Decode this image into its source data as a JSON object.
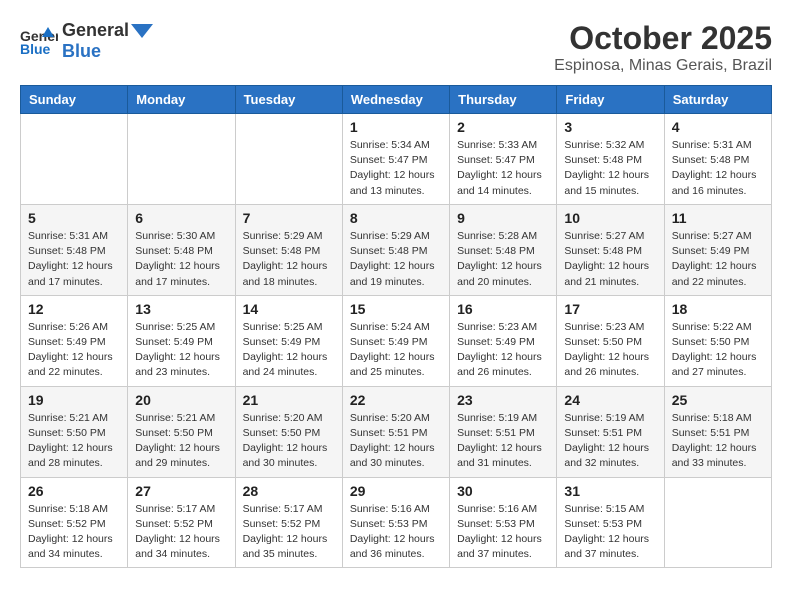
{
  "header": {
    "logo_general": "General",
    "logo_blue": "Blue",
    "month_year": "October 2025",
    "location": "Espinosa, Minas Gerais, Brazil"
  },
  "weekdays": [
    "Sunday",
    "Monday",
    "Tuesday",
    "Wednesday",
    "Thursday",
    "Friday",
    "Saturday"
  ],
  "weeks": [
    [
      {
        "day": "",
        "info": ""
      },
      {
        "day": "",
        "info": ""
      },
      {
        "day": "",
        "info": ""
      },
      {
        "day": "1",
        "info": "Sunrise: 5:34 AM\nSunset: 5:47 PM\nDaylight: 12 hours\nand 13 minutes."
      },
      {
        "day": "2",
        "info": "Sunrise: 5:33 AM\nSunset: 5:47 PM\nDaylight: 12 hours\nand 14 minutes."
      },
      {
        "day": "3",
        "info": "Sunrise: 5:32 AM\nSunset: 5:48 PM\nDaylight: 12 hours\nand 15 minutes."
      },
      {
        "day": "4",
        "info": "Sunrise: 5:31 AM\nSunset: 5:48 PM\nDaylight: 12 hours\nand 16 minutes."
      }
    ],
    [
      {
        "day": "5",
        "info": "Sunrise: 5:31 AM\nSunset: 5:48 PM\nDaylight: 12 hours\nand 17 minutes."
      },
      {
        "day": "6",
        "info": "Sunrise: 5:30 AM\nSunset: 5:48 PM\nDaylight: 12 hours\nand 17 minutes."
      },
      {
        "day": "7",
        "info": "Sunrise: 5:29 AM\nSunset: 5:48 PM\nDaylight: 12 hours\nand 18 minutes."
      },
      {
        "day": "8",
        "info": "Sunrise: 5:29 AM\nSunset: 5:48 PM\nDaylight: 12 hours\nand 19 minutes."
      },
      {
        "day": "9",
        "info": "Sunrise: 5:28 AM\nSunset: 5:48 PM\nDaylight: 12 hours\nand 20 minutes."
      },
      {
        "day": "10",
        "info": "Sunrise: 5:27 AM\nSunset: 5:48 PM\nDaylight: 12 hours\nand 21 minutes."
      },
      {
        "day": "11",
        "info": "Sunrise: 5:27 AM\nSunset: 5:49 PM\nDaylight: 12 hours\nand 22 minutes."
      }
    ],
    [
      {
        "day": "12",
        "info": "Sunrise: 5:26 AM\nSunset: 5:49 PM\nDaylight: 12 hours\nand 22 minutes."
      },
      {
        "day": "13",
        "info": "Sunrise: 5:25 AM\nSunset: 5:49 PM\nDaylight: 12 hours\nand 23 minutes."
      },
      {
        "day": "14",
        "info": "Sunrise: 5:25 AM\nSunset: 5:49 PM\nDaylight: 12 hours\nand 24 minutes."
      },
      {
        "day": "15",
        "info": "Sunrise: 5:24 AM\nSunset: 5:49 PM\nDaylight: 12 hours\nand 25 minutes."
      },
      {
        "day": "16",
        "info": "Sunrise: 5:23 AM\nSunset: 5:49 PM\nDaylight: 12 hours\nand 26 minutes."
      },
      {
        "day": "17",
        "info": "Sunrise: 5:23 AM\nSunset: 5:50 PM\nDaylight: 12 hours\nand 26 minutes."
      },
      {
        "day": "18",
        "info": "Sunrise: 5:22 AM\nSunset: 5:50 PM\nDaylight: 12 hours\nand 27 minutes."
      }
    ],
    [
      {
        "day": "19",
        "info": "Sunrise: 5:21 AM\nSunset: 5:50 PM\nDaylight: 12 hours\nand 28 minutes."
      },
      {
        "day": "20",
        "info": "Sunrise: 5:21 AM\nSunset: 5:50 PM\nDaylight: 12 hours\nand 29 minutes."
      },
      {
        "day": "21",
        "info": "Sunrise: 5:20 AM\nSunset: 5:50 PM\nDaylight: 12 hours\nand 30 minutes."
      },
      {
        "day": "22",
        "info": "Sunrise: 5:20 AM\nSunset: 5:51 PM\nDaylight: 12 hours\nand 30 minutes."
      },
      {
        "day": "23",
        "info": "Sunrise: 5:19 AM\nSunset: 5:51 PM\nDaylight: 12 hours\nand 31 minutes."
      },
      {
        "day": "24",
        "info": "Sunrise: 5:19 AM\nSunset: 5:51 PM\nDaylight: 12 hours\nand 32 minutes."
      },
      {
        "day": "25",
        "info": "Sunrise: 5:18 AM\nSunset: 5:51 PM\nDaylight: 12 hours\nand 33 minutes."
      }
    ],
    [
      {
        "day": "26",
        "info": "Sunrise: 5:18 AM\nSunset: 5:52 PM\nDaylight: 12 hours\nand 34 minutes."
      },
      {
        "day": "27",
        "info": "Sunrise: 5:17 AM\nSunset: 5:52 PM\nDaylight: 12 hours\nand 34 minutes."
      },
      {
        "day": "28",
        "info": "Sunrise: 5:17 AM\nSunset: 5:52 PM\nDaylight: 12 hours\nand 35 minutes."
      },
      {
        "day": "29",
        "info": "Sunrise: 5:16 AM\nSunset: 5:53 PM\nDaylight: 12 hours\nand 36 minutes."
      },
      {
        "day": "30",
        "info": "Sunrise: 5:16 AM\nSunset: 5:53 PM\nDaylight: 12 hours\nand 37 minutes."
      },
      {
        "day": "31",
        "info": "Sunrise: 5:15 AM\nSunset: 5:53 PM\nDaylight: 12 hours\nand 37 minutes."
      },
      {
        "day": "",
        "info": ""
      }
    ]
  ]
}
